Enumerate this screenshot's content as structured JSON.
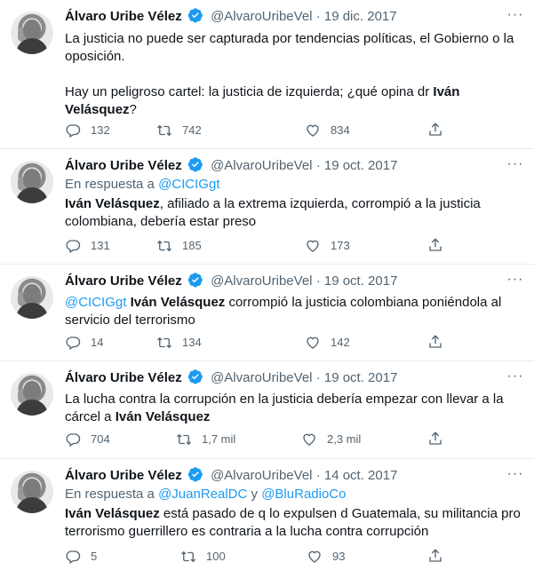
{
  "tweets": [
    {
      "name": "Álvaro Uribe Vélez",
      "handle": "@AlvaroUribeVel",
      "separator": "·",
      "date": "19 dic. 2017",
      "more": "···",
      "reply_prefix": "",
      "reply_to_1": "",
      "reply_joiner": "",
      "reply_to_2": "",
      "text_p1": "La justicia no puede ser capturada por tendencias políticas, el Gobierno o la oposición.",
      "text_p2_a": "Hay un peligroso cartel: la justicia de izquierda; ¿qué opina dr ",
      "text_p2_b": "Iván Velásquez",
      "text_p2_c": "?",
      "replies": "132",
      "retweets": "742",
      "likes": "834"
    },
    {
      "name": "Álvaro Uribe Vélez",
      "handle": "@AlvaroUribeVel",
      "separator": "·",
      "date": "19 oct. 2017",
      "more": "···",
      "reply_prefix": "En respuesta a ",
      "reply_to_1": "@CICIGgt",
      "text_b": "Iván Velásquez",
      "text_rest": ", afiliado a la extrema izquierda, corrompió a la justicia colombiana, debería estar preso",
      "replies": "131",
      "retweets": "185",
      "likes": "173"
    },
    {
      "name": "Álvaro Uribe Vélez",
      "handle": "@AlvaroUribeVel",
      "separator": "·",
      "date": "19 oct. 2017",
      "more": "···",
      "text_link": "@CICIGgt",
      "text_b": " Iván Velásquez",
      "text_rest": " corrompió la justicia colombiana poniéndola al servicio del terrorismo",
      "replies": "14",
      "retweets": "134",
      "likes": "142"
    },
    {
      "name": "Álvaro Uribe Vélez",
      "handle": "@AlvaroUribeVel",
      "separator": "·",
      "date": "19 oct. 2017",
      "more": "···",
      "text_a": "La lucha contra la corrupción en la justicia debería empezar con llevar a la cárcel a ",
      "text_b": "Iván Velásquez",
      "replies": "704",
      "retweets": "1,7 mil",
      "likes": "2,3 mil"
    },
    {
      "name": "Álvaro Uribe Vélez",
      "handle": "@AlvaroUribeVel",
      "separator": "·",
      "date": "14 oct. 2017",
      "more": "···",
      "reply_prefix": "En respuesta a ",
      "reply_to_1": "@JuanRealDC",
      "reply_joiner": " y ",
      "reply_to_2": "@BluRadioCo",
      "text_b": "Iván Velásquez",
      "text_rest": " está pasado de q lo expulsen d Guatemala, su militancia pro terrorismo guerrillero es contraria a la lucha contra corrupción",
      "replies": "5",
      "retweets": "100",
      "likes": "93"
    }
  ],
  "colors": {
    "link": "#1d9bf0",
    "muted": "#536471",
    "text": "#0f1419",
    "divider": "#e6ecf0"
  },
  "icons": [
    "reply-icon",
    "retweet-icon",
    "like-icon",
    "share-icon",
    "verified-badge-icon",
    "more-icon"
  ]
}
